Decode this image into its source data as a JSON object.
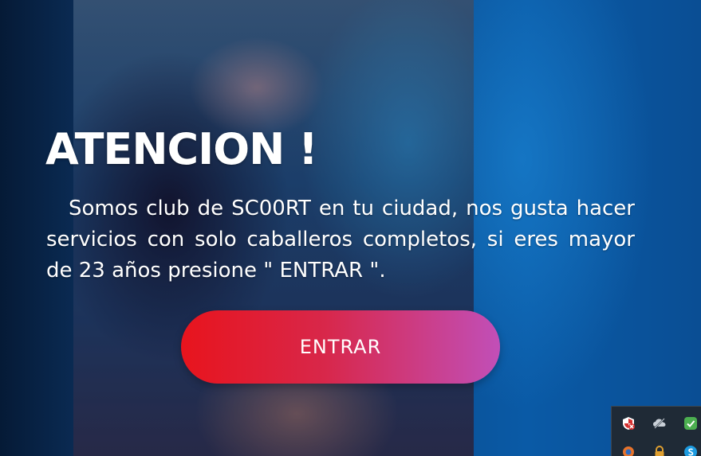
{
  "notice": {
    "title": "ATENCION !",
    "message": "Somos club de SC00RT en tu ciudad, nos gusta hacer servicios con solo caballeros completos, si eres mayor de 23 años presione \" ENTRAR \".",
    "button_label": "ENTRAR"
  },
  "colors": {
    "button_gradient_start": "#e8141d",
    "button_gradient_end": "#c14fb8",
    "background_blue": "#0a5aa6",
    "text": "#ffffff"
  },
  "tray": {
    "icons": [
      "shield-alert-icon",
      "cloud-offline-icon",
      "security-check-icon",
      "browser-icon",
      "lock-icon",
      "skype-icon"
    ]
  }
}
